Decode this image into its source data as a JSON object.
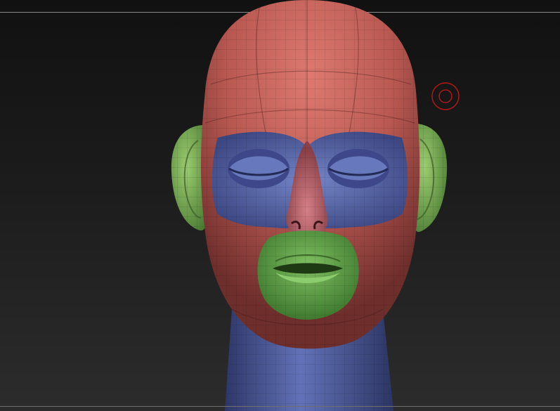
{
  "viewport": {
    "background": "#1a1a1a",
    "guide_line_color": "#8a8a8a"
  },
  "model": {
    "polygroups": [
      {
        "id": "head",
        "color": "#c2625c"
      },
      {
        "id": "eyes",
        "color": "#5f6fb2"
      },
      {
        "id": "mouth",
        "color": "#6aa650"
      },
      {
        "id": "ears",
        "color": "#7fae58"
      },
      {
        "id": "neck",
        "color": "#5a6aa8"
      },
      {
        "id": "nose",
        "color": "#c06a72"
      }
    ],
    "wireframe_color": "#2a1a1a"
  },
  "cursor": {
    "icon": "brush-cursor-icon",
    "color": "#b01818"
  }
}
